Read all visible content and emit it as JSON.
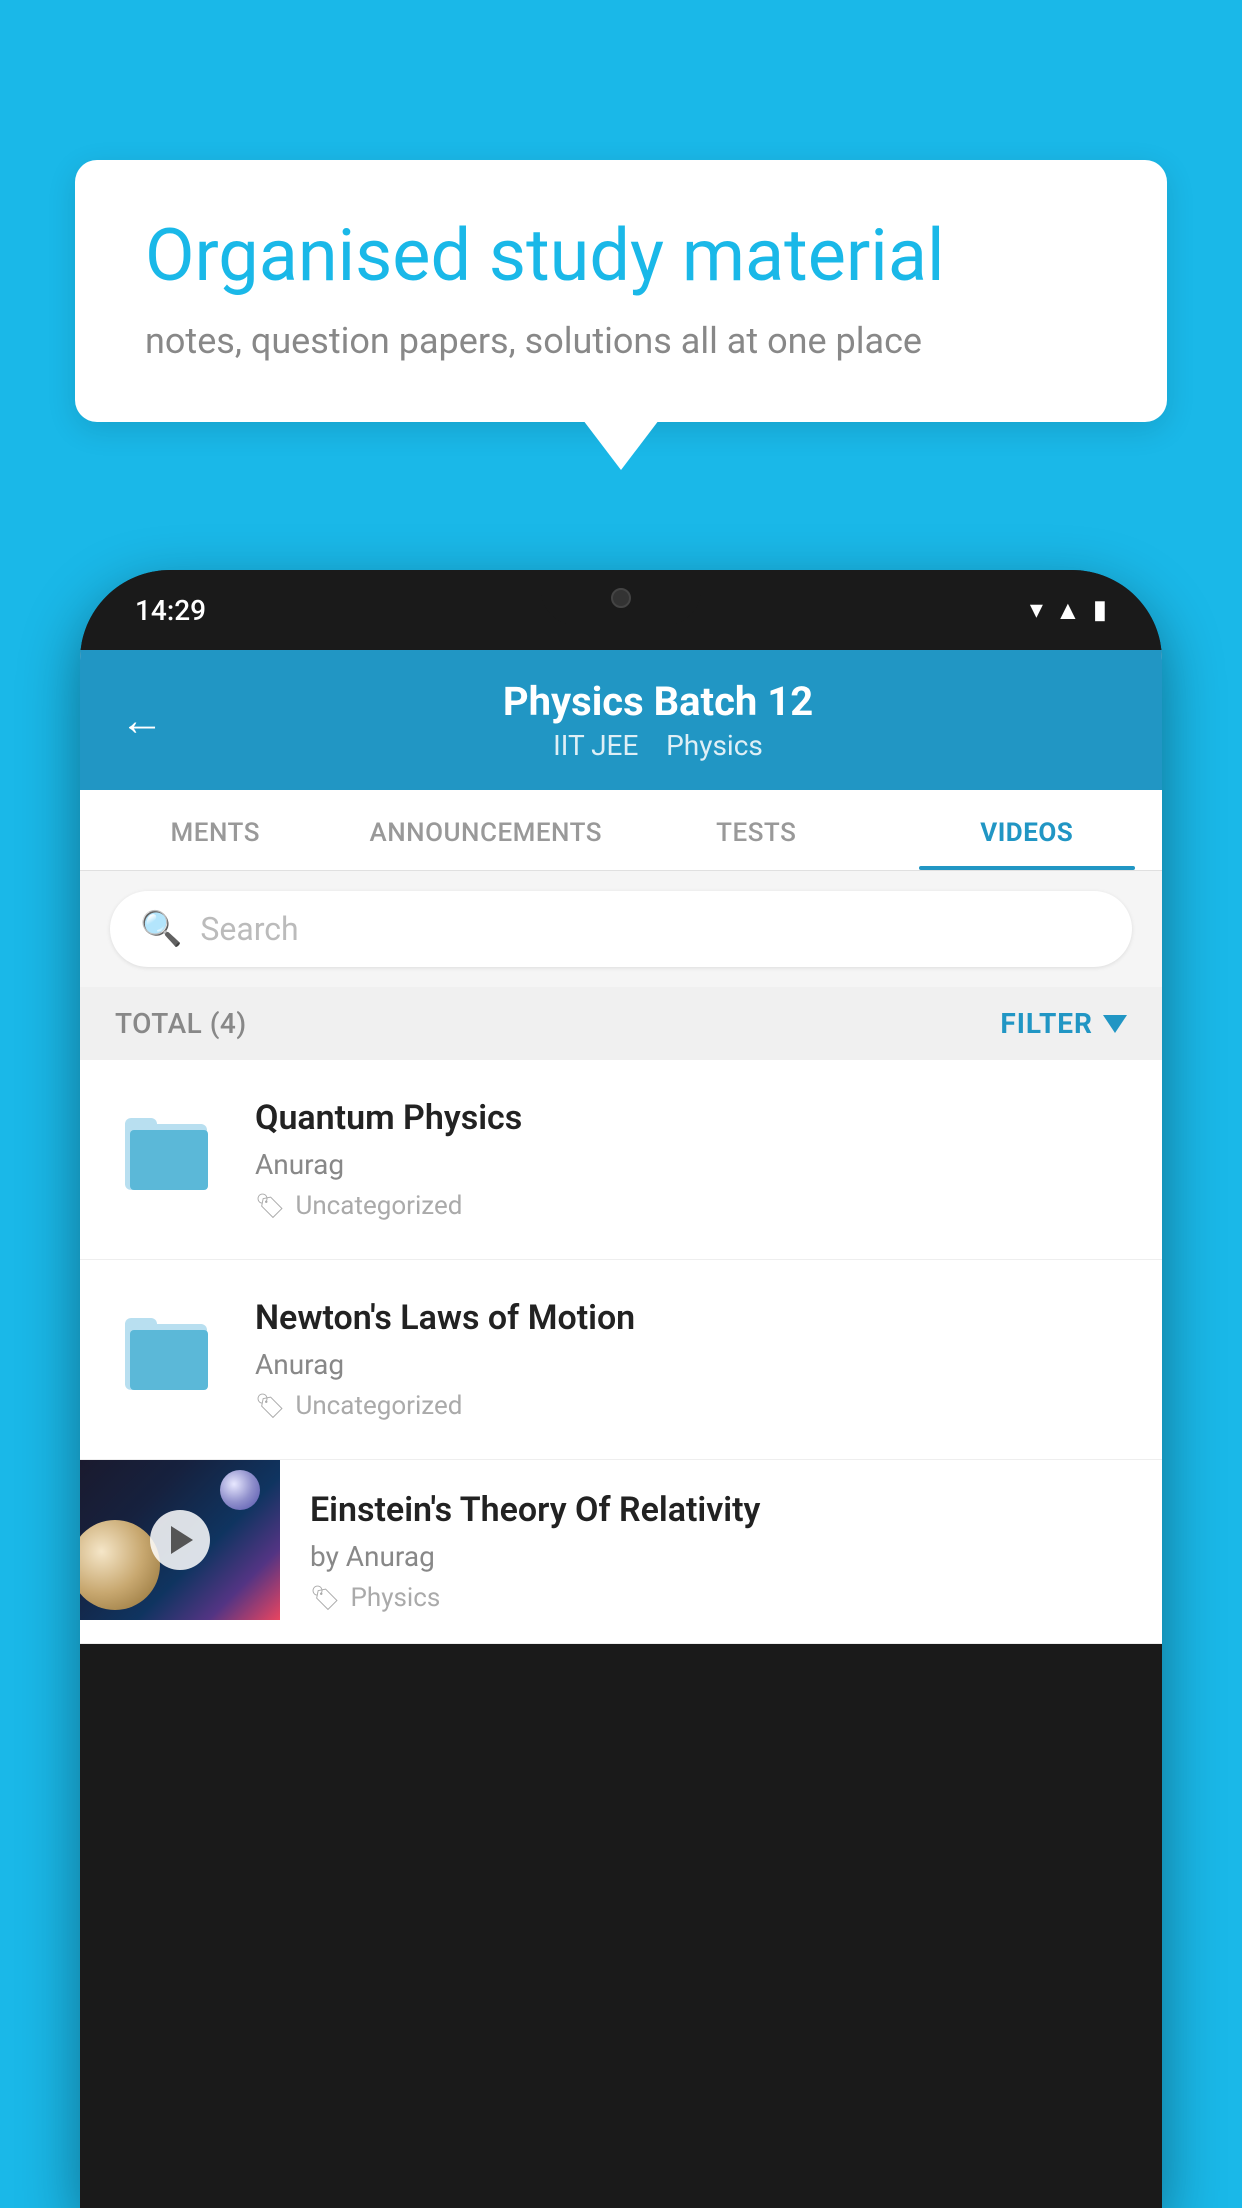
{
  "background_color": "#1ab8e8",
  "bubble": {
    "title": "Organised study material",
    "subtitle": "notes, question papers, solutions all at one place"
  },
  "phone": {
    "status_time": "14:29",
    "header": {
      "title": "Physics Batch 12",
      "subtitle_part1": "IIT JEE",
      "subtitle_part2": "Physics"
    },
    "tabs": [
      {
        "label": "MENTS",
        "active": false
      },
      {
        "label": "ANNOUNCEMENTS",
        "active": false
      },
      {
        "label": "TESTS",
        "active": false
      },
      {
        "label": "VIDEOS",
        "active": true
      }
    ],
    "search": {
      "placeholder": "Search"
    },
    "filter_bar": {
      "total_label": "TOTAL (4)",
      "filter_label": "FILTER"
    },
    "videos": [
      {
        "title": "Quantum Physics",
        "author": "Anurag",
        "tag": "Uncategorized",
        "has_thumb": false,
        "thumb_tag": ""
      },
      {
        "title": "Newton's Laws of Motion",
        "author": "Anurag",
        "tag": "Uncategorized",
        "has_thumb": false,
        "thumb_tag": ""
      },
      {
        "title": "Einstein's Theory Of Relativity",
        "author": "by Anurag",
        "tag": "Physics",
        "has_thumb": true,
        "thumb_tag": ""
      }
    ]
  }
}
